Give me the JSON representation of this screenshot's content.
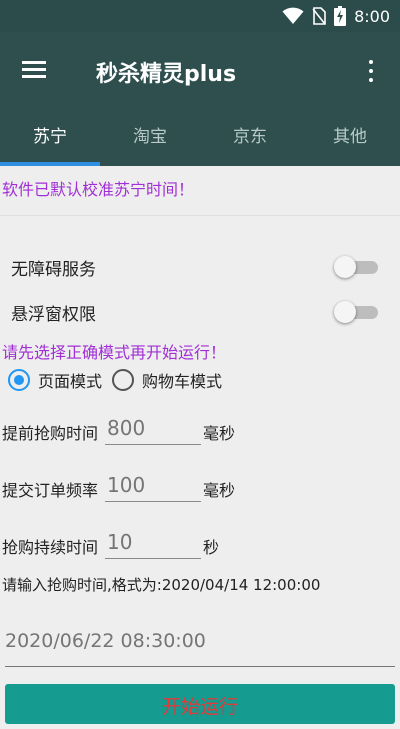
{
  "status_bar": {
    "time": "8:00",
    "icons": [
      "wifi-icon",
      "no-sim-icon",
      "battery-charging-icon"
    ]
  },
  "app_bar": {
    "title": "秒杀精灵plus",
    "menu_icon": "hamburger-menu-icon",
    "overflow_icon": "more-vert-icon"
  },
  "tabs": [
    {
      "label": "苏宁",
      "active": true
    },
    {
      "label": "淘宝",
      "active": false
    },
    {
      "label": "京东",
      "active": false
    },
    {
      "label": "其他",
      "active": false
    }
  ],
  "notice": "软件已默认校准苏宁时间！",
  "toggles": [
    {
      "label": "无障碍服务",
      "on": false
    },
    {
      "label": "悬浮窗权限",
      "on": false
    }
  ],
  "mode_warning": "请先选择正确模式再开始运行！",
  "modes": [
    {
      "label": "页面模式",
      "checked": true
    },
    {
      "label": "购物车模式",
      "checked": false
    }
  ],
  "fields": [
    {
      "label": "提前抢购时间",
      "placeholder": "800",
      "unit": "毫秒"
    },
    {
      "label": "提交订单频率",
      "placeholder": "100",
      "unit": "毫秒"
    },
    {
      "label": "抢购持续时间",
      "placeholder": "10",
      "unit": "秒"
    }
  ],
  "time_hint": "请输入抢购时间,格式为:2020/04/14 12:00:00",
  "time_input": {
    "placeholder": "2020/06/22 08:30:00"
  },
  "start_button": {
    "label": "开始运行"
  },
  "colors": {
    "app_bar": "#2f4f4f",
    "tab_indicator": "#2f8fe0",
    "notice_text": "#a12fd6",
    "radio_accent": "#2196f3",
    "button_bg": "#159b8f",
    "button_text": "#e03a3a"
  }
}
